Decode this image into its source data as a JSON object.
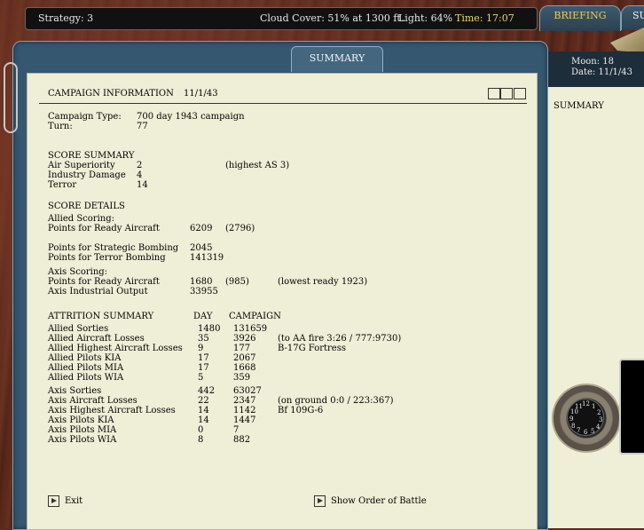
{
  "topbar": {
    "strategy": "Strategy:  3",
    "cloud": "Cloud Cover:  51% at 1300 ft.",
    "light": "Light:  64%",
    "time": "Time:  17:07"
  },
  "tabs": {
    "briefing": "BRIEFING",
    "su": "SU"
  },
  "frame_tab": "SUMMARY",
  "right_panel": {
    "moon": "Moon:  18",
    "date": "Date:  11/1/43",
    "summary": "SUMMARY"
  },
  "header": {
    "title": "CAMPAIGN INFORMATION",
    "date": "11/1/43"
  },
  "campaign": {
    "type_label": "Campaign Type:",
    "type_value": "700 day 1943 campaign",
    "turn_label": "Turn:",
    "turn_value": "77"
  },
  "score_summary": {
    "heading": "SCORE SUMMARY",
    "rows": [
      {
        "label": "Air Superiority",
        "value": "2",
        "note": "(highest AS 3)"
      },
      {
        "label": "Industry Damage",
        "value": "4",
        "note": ""
      },
      {
        "label": "Terror",
        "value": "14",
        "note": ""
      }
    ]
  },
  "score_details": {
    "heading": "SCORE DETAILS",
    "allied_heading": "Allied Scoring:",
    "allied_ready_label": "Points for Ready Aircraft",
    "allied_ready_value": "6209",
    "allied_ready_extra": "(2796)",
    "strategic_label": "Points for Strategic Bombing",
    "strategic_value": "2045",
    "terror_label": "Points for Terror Bombing",
    "terror_value": "141319",
    "axis_heading": "Axis Scoring:",
    "axis_ready_label": "Points for Ready Aircraft",
    "axis_ready_value": "1680",
    "axis_ready_extra": "(985)",
    "axis_ready_note": "(lowest ready 1923)",
    "industrial_label": "Axis Industrial Output",
    "industrial_value": "33955"
  },
  "attrition": {
    "heading": "ATTRITION SUMMARY",
    "col_day": "DAY",
    "col_campaign": "CAMPAIGN",
    "allied": [
      {
        "label": "Allied Sorties",
        "day": "1480",
        "campaign": "131659",
        "note": ""
      },
      {
        "label": "Allied Aircraft Losses",
        "day": "35",
        "campaign": "3926",
        "note": "(to AA fire 3:26 / 777:9730)"
      },
      {
        "label": "Allied Highest Aircraft Losses",
        "day": "9",
        "campaign": "177",
        "note": "B-17G Fortress"
      },
      {
        "label": "Allied Pilots KIA",
        "day": "17",
        "campaign": "2067",
        "note": ""
      },
      {
        "label": "Allied Pilots MIA",
        "day": "17",
        "campaign": "1668",
        "note": ""
      },
      {
        "label": "Allied Pilots WIA",
        "day": "5",
        "campaign": "359",
        "note": ""
      }
    ],
    "axis": [
      {
        "label": "Axis Sorties",
        "day": "442",
        "campaign": "63027",
        "note": ""
      },
      {
        "label": "Axis Aircraft Losses",
        "day": "22",
        "campaign": "2347",
        "note": "(on ground 0:0 / 223:367)"
      },
      {
        "label": "Axis Highest Aircraft Losses",
        "day": "14",
        "campaign": "1142",
        "note": "Bf 109G-6"
      },
      {
        "label": "Axis Pilots KIA",
        "day": "14",
        "campaign": "1447",
        "note": ""
      },
      {
        "label": "Axis Pilots MIA",
        "day": "0",
        "campaign": "7",
        "note": ""
      },
      {
        "label": "Axis Pilots WIA",
        "day": "8",
        "campaign": "882",
        "note": ""
      }
    ]
  },
  "buttons": {
    "exit": "Exit",
    "order": "Show Order of Battle"
  },
  "clock": {
    "n12": "12",
    "n1": "1",
    "n2": "2",
    "n3": "3",
    "n4": "4",
    "n5": "5",
    "n6": "6",
    "n7": "7",
    "n8": "8",
    "n9": "9",
    "n10": "10",
    "n11": "11"
  }
}
